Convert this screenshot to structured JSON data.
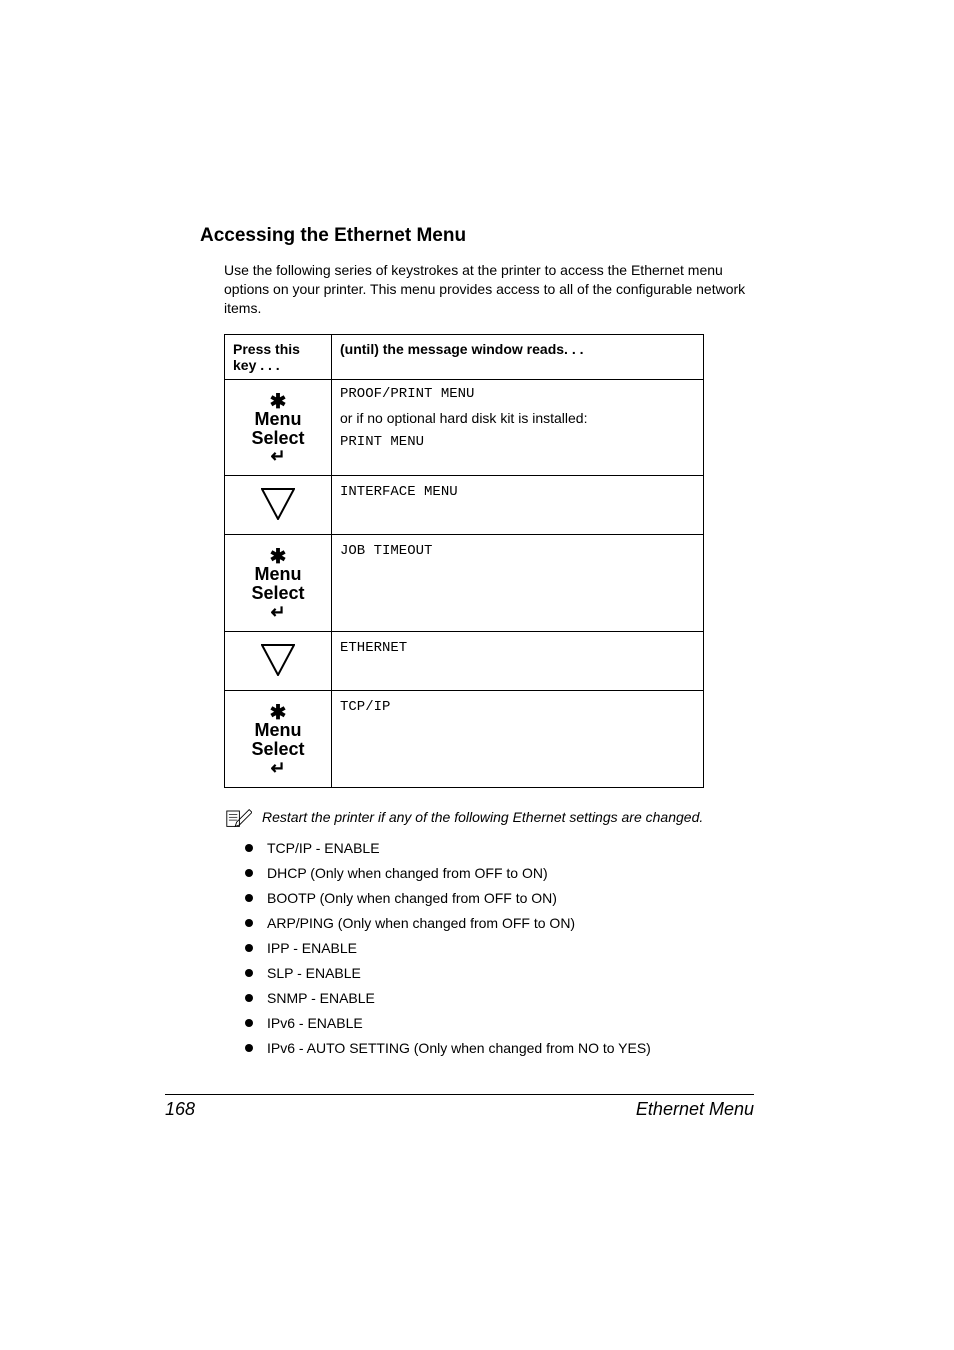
{
  "heading": "Accessing the Ethernet Menu",
  "intro": "Use the following series of keystrokes at the printer to access the Ethernet menu options on your printer. This menu provides access to all of the configurable network items.",
  "table": {
    "header": {
      "key": "Press this key . . .",
      "msg": "(until) the message window reads. . ."
    },
    "rows": [
      {
        "key_icon": "menu-select",
        "msg": {
          "line1": "PROOF/PRINT MENU",
          "mid": "or if no optional hard disk kit is installed:",
          "line2": "PRINT MENU"
        }
      },
      {
        "key_icon": "down",
        "msg": {
          "mono": "INTERFACE MENU"
        }
      },
      {
        "key_icon": "menu-select",
        "msg": {
          "mono": "JOB TIMEOUT"
        }
      },
      {
        "key_icon": "down",
        "msg": {
          "mono": "ETHERNET"
        }
      },
      {
        "key_icon": "menu-select",
        "msg": {
          "mono": "TCP/IP"
        }
      }
    ],
    "menu_select_labels": {
      "menu": "Menu",
      "select": "Select"
    }
  },
  "note": "Restart the printer if any of the following Ethernet settings are changed.",
  "settings_list": [
    "TCP/IP - ENABLE",
    "DHCP (Only when changed from OFF to ON)",
    "BOOTP (Only when changed from OFF to ON)",
    "ARP/PING (Only when changed from OFF to ON)",
    "IPP - ENABLE",
    "SLP - ENABLE",
    "SNMP - ENABLE",
    "IPv6 - ENABLE",
    "IPv6 - AUTO SETTING (Only when changed from NO to YES)"
  ],
  "footer": {
    "page": "168",
    "title": "Ethernet Menu"
  }
}
